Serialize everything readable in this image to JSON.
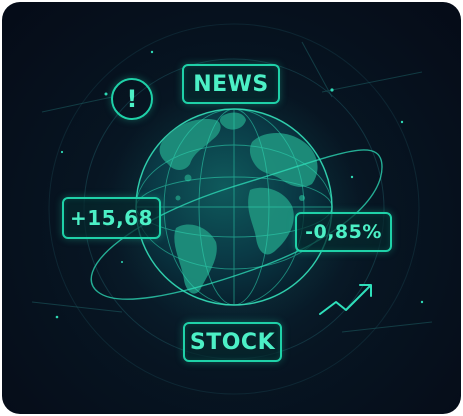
{
  "tags": {
    "news": "NEWS",
    "change_up": "+15,68",
    "change_down": "-0,85%",
    "stock": "STOCK"
  },
  "icons": {
    "alert": "exclamation-circle-icon",
    "trend": "trend-up-arrow-icon",
    "globe": "globe-icon"
  },
  "colors": {
    "accent": "#1fd1a8",
    "text": "#4cf0c6",
    "background": "#050b17"
  }
}
